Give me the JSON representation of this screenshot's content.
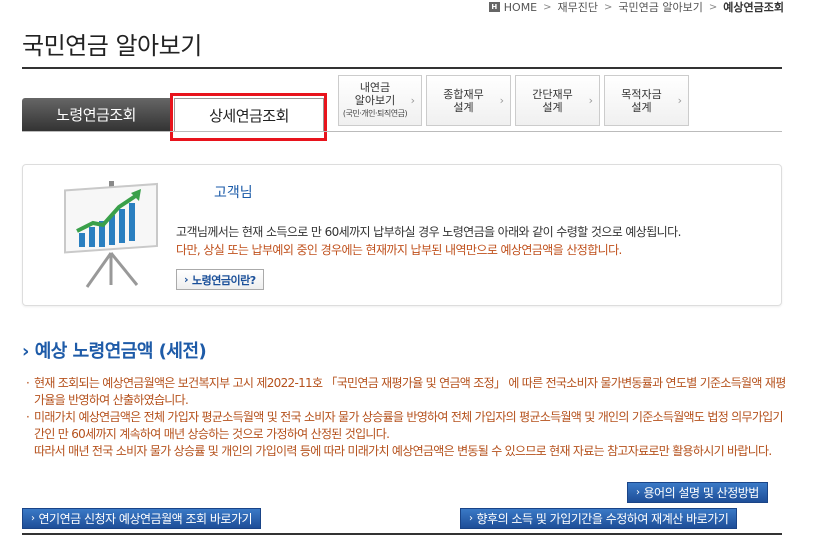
{
  "breadcrumb": {
    "home": "HOME",
    "items": [
      "재무진단",
      "국민연금 알아보기"
    ],
    "current": "예상연금조회"
  },
  "page_title": "국민연금 알아보기",
  "tabs": {
    "main": [
      {
        "label": "노령연금조회"
      },
      {
        "label": "상세연금조회"
      }
    ],
    "side": [
      {
        "line1": "내연금",
        "line2": "알아보기",
        "line3": "(국민·개인·퇴직연금)"
      },
      {
        "line1": "종합재무",
        "line2": "설계"
      },
      {
        "line1": "간단재무",
        "line2": "설계"
      },
      {
        "line1": "목적자금",
        "line2": "설계"
      }
    ]
  },
  "info": {
    "customer": "고객님",
    "desc1": "고객님께서는 현재 소득으로 만 60세까지 납부하실 경우 노령연금을 아래와 같이 수령할 것으로 예상됩니다.",
    "desc2": "다만, 상실 또는 납부예외 중인 경우에는 현재까지 납부된 내역만으로 예상연금액을 산정합니다.",
    "link": "노령연금이란?"
  },
  "section": {
    "title": "예상 노령연금액 (세전)",
    "notes": [
      "현재 조회되는 예상연금월액은 보건복지부 고시 제2022-11호 「국민연금 재평가율 및 연금액 조정」 에 따른 전국소비자 물가변동률과 연도별 기준소득월액 재평가율을 반영하여 산출하였습니다.",
      "미래가치 예상연금액은 전체 가입자 평균소득월액 및 전국 소비자 물가 상승률을 반영하여 전체 가입자의 평균소득월액 및 개인의 기준소득월액도 법정 의무가입기간인 만 60세까지 계속하여 매년 상승하는 것으로 가정하여 산정된 것입니다."
    ],
    "note_continued": "따라서 매년 전국 소비자 물가 상승률 및 개인의 가입이력 등에 따라 미래가치 예상연금액은 변동될 수 있으므로 현재 자료는 참고자료로만 활용하시기 바랍니다."
  },
  "buttons": {
    "terms": "용어의 설명 및 산정방법",
    "deferred": "연기연금 신청자 예상연금월액 조회 바로가기",
    "recalc": "향후의 소득 및 가입기간을 수정하여 재계산 바로가기"
  }
}
